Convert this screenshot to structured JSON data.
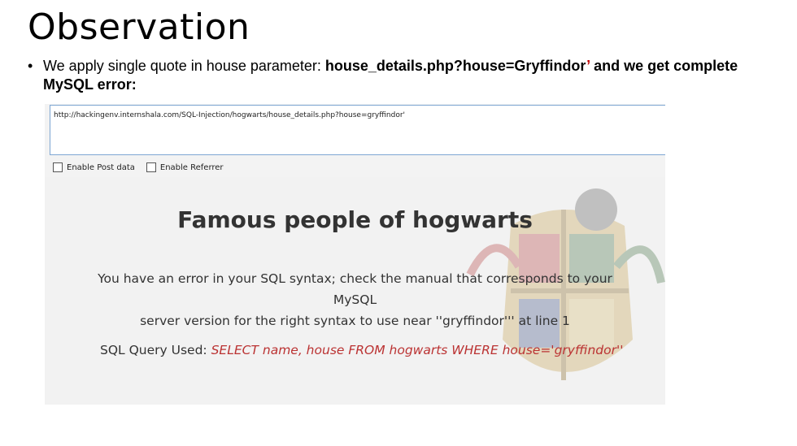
{
  "slide": {
    "title": "Observation",
    "bullet_prefix": "We apply single quote in house parameter: ",
    "bullet_url": "house_details.php?house=Gryffindor",
    "bullet_quote": "’",
    "bullet_suffix": " and we get complete MySQL error:"
  },
  "browser": {
    "url": "http://hackingenv.internshala.com/SQL-Injection/hogwarts/house_details.php?house=gryffindor'",
    "enable_post": "Enable Post data",
    "enable_referrer": "Enable Referrer"
  },
  "page": {
    "heading": "Famous people of hogwarts",
    "error_line1": "You have an error in your SQL syntax; check the manual that corresponds to your MySQL",
    "error_line2": "server version for the right syntax to use near ''gryffindor''' at line 1",
    "sql_label": "SQL Query Used: ",
    "sql_query": "SELECT name, house FROM hogwarts WHERE house='gryffindor''"
  }
}
